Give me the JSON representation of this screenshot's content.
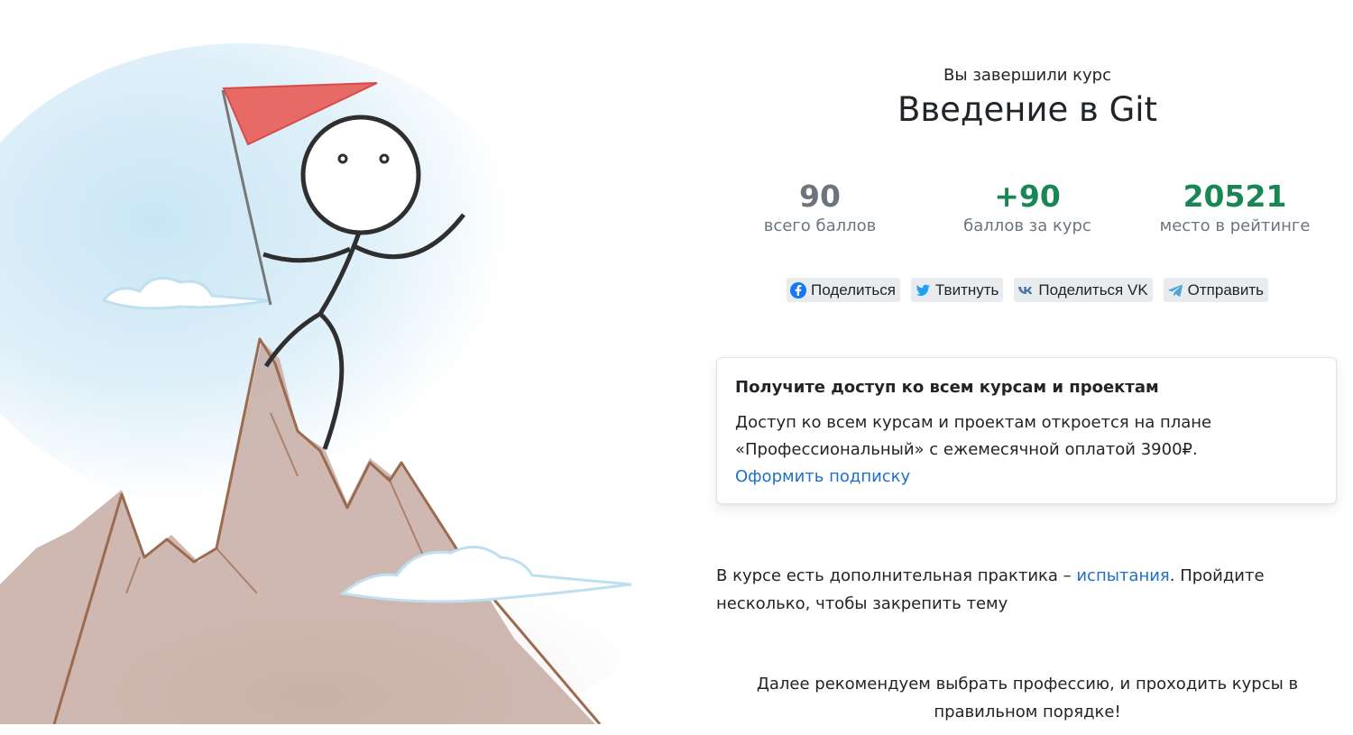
{
  "completion": {
    "subtitle": "Вы завершили курс",
    "course_title": "Введение в Git"
  },
  "stats": [
    {
      "value": "90",
      "label": "всего баллов",
      "color": "#6c757d"
    },
    {
      "value": "+90",
      "label": "баллов за курс",
      "color": "#198754"
    },
    {
      "value": "20521",
      "label": "место в рейтинге",
      "color": "#198754"
    }
  ],
  "share": {
    "facebook": {
      "label": "Поделиться",
      "icon": "facebook-icon"
    },
    "twitter": {
      "label": "Твитнуть",
      "icon": "twitter-icon"
    },
    "vk": {
      "label": "Поделиться VK",
      "icon": "vk-icon"
    },
    "telegram": {
      "label": "Отправить",
      "icon": "telegram-icon"
    }
  },
  "subscription_card": {
    "title": "Получите доступ ко всем курсам и проектам",
    "text_line1": "Доступ ко всем курсам и проектам откроется на плане",
    "text_line2": "«Профессиональный» с ежемесячной оплатой 3900₽.",
    "link_label": "Оформить подписку"
  },
  "practice": {
    "text_before": "В курсе есть дополнительная практика – ",
    "link_label": "испытания",
    "text_after": ". Пройдите несколько, чтобы закрепить тему"
  },
  "recommendation": {
    "line1": "Далее рекомендуем выбрать профессию, и проходить курсы в",
    "line2": "правильном порядке!"
  },
  "colors": {
    "link": "#1f6fc5",
    "success": "#198754",
    "muted": "#6c757d",
    "flag": "#e5504f"
  }
}
